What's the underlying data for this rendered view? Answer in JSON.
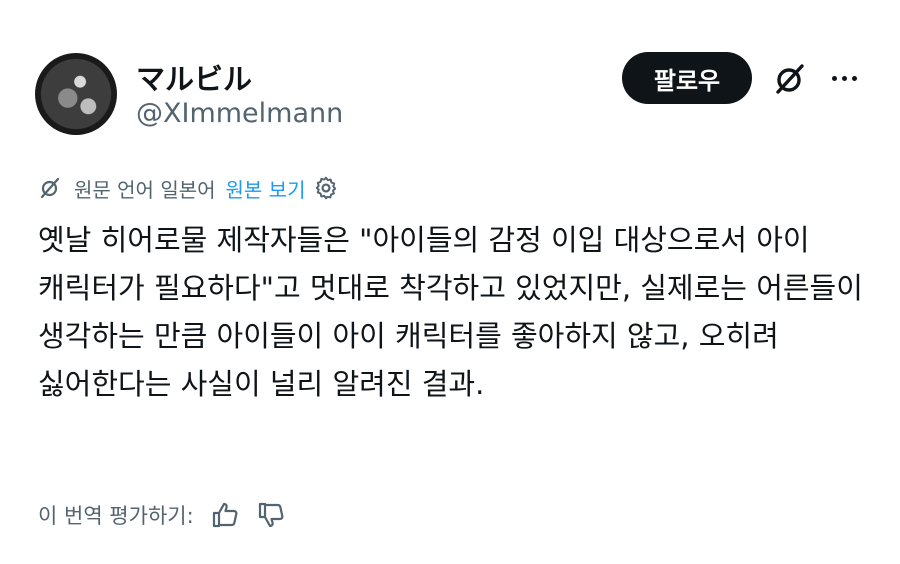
{
  "author": {
    "display_name": "マルビル",
    "handle": "@XImmelmann"
  },
  "actions": {
    "follow_label": "팔로우",
    "grok_icon": "grok-icon",
    "more_icon": "more-icon"
  },
  "translation": {
    "source_label": "원문 언어 일본어",
    "show_original_label": "원본 보기",
    "settings_icon": "gear-icon",
    "link_color": "#1d9bf0"
  },
  "tweet": {
    "text": "옛날 히어로물 제작자들은 \"아이들의 감정 이입 대상으로서 아이 캐릭터가 필요하다\"고 멋대로 착각하고 있었지만, 실제로는 어른들이 생각하는 만큼 아이들이 아이 캐릭터를 좋아하지 않고, 오히려 싫어한다는 사실이 널리 알려진 결과."
  },
  "rating": {
    "prompt": "이 번역 평가하기:",
    "like_icon": "thumbs-up-icon",
    "dislike_icon": "thumbs-down-icon"
  },
  "colors": {
    "text_primary": "#0f1419",
    "text_secondary": "#536471",
    "button_bg": "#0f1419"
  }
}
